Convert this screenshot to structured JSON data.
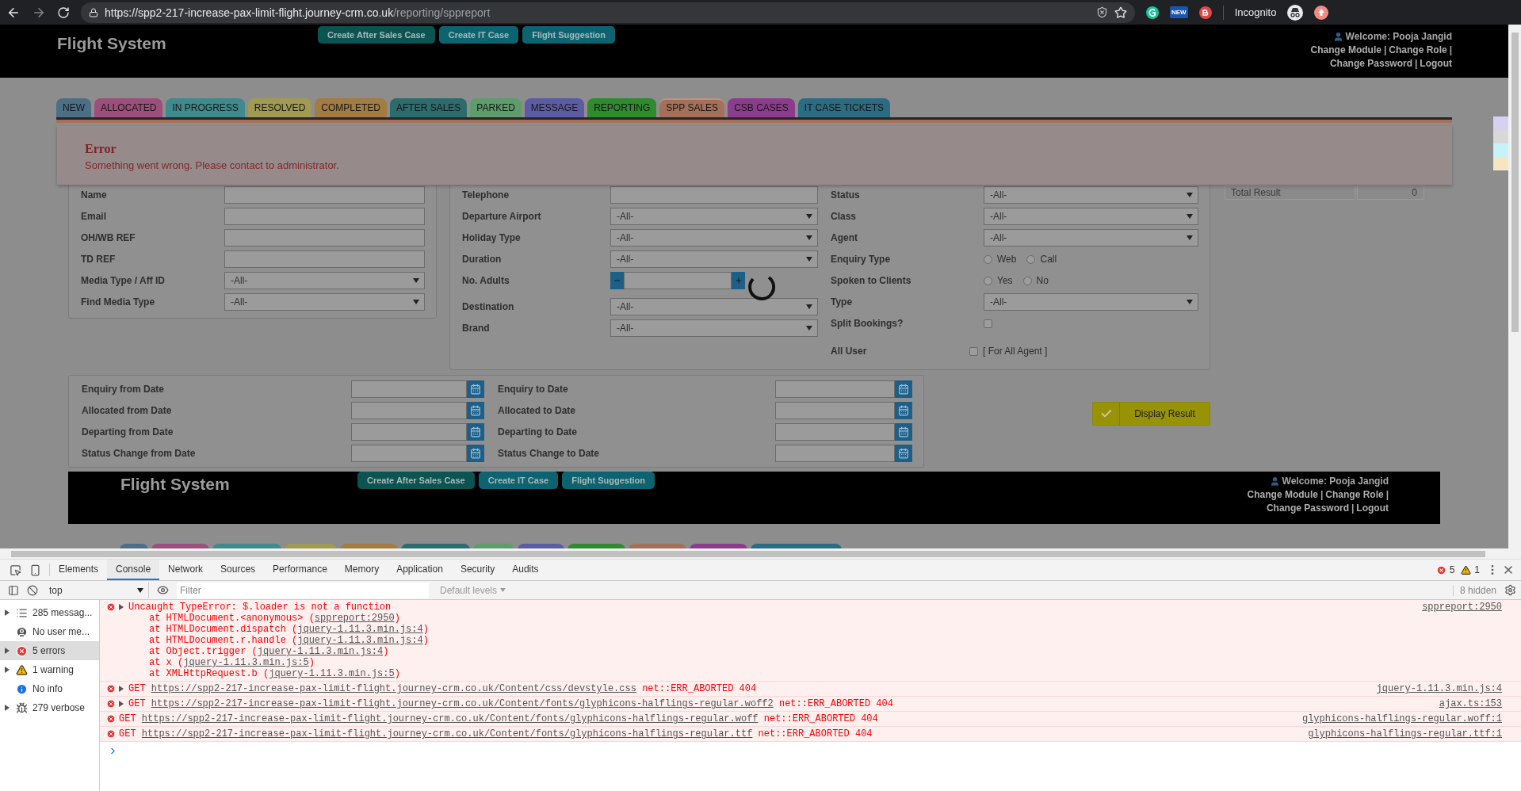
{
  "browser": {
    "url_host": "https://spp2-217-increase-pax-limit-flight.journey-crm.co.uk",
    "url_path": "/reporting/sppreport",
    "extension_badge": "NEW",
    "profile": "Incognito"
  },
  "header": {
    "title": "Flight System",
    "buttons": [
      "Create After Sales Case",
      "Create IT Case",
      "Flight Suggestion"
    ],
    "welcome": "Welcome: Pooja Jangid",
    "link_rows": [
      [
        {
          "kind": "link",
          "text": "Change Module"
        },
        {
          "kind": "separator",
          "text": "|"
        },
        {
          "kind": "link",
          "text": "Change Role"
        },
        {
          "kind": "separator",
          "text": "|"
        }
      ],
      [
        {
          "kind": "link",
          "text": "Change Password"
        },
        {
          "kind": "separator",
          "text": "|"
        },
        {
          "kind": "link",
          "text": "Logout"
        }
      ]
    ]
  },
  "tabs": [
    {
      "label": "NEW",
      "color": "#4d6f86",
      "selected": false
    },
    {
      "label": "ALLOCATED",
      "color": "#9c4f7c",
      "selected": false
    },
    {
      "label": "IN PROGRESS",
      "color": "#3f8a8c",
      "selected": false
    },
    {
      "label": "RESOLVED",
      "color": "#a09a52",
      "selected": false
    },
    {
      "label": "COMPLETED",
      "color": "#a37c42",
      "selected": false
    },
    {
      "label": "AFTER SALES",
      "color": "#2c6c6c",
      "selected": false
    },
    {
      "label": "PARKED",
      "color": "#5e9c6c",
      "selected": false
    },
    {
      "label": "MESSAGE",
      "color": "#5c5ca4",
      "selected": false
    },
    {
      "label": "REPORTING",
      "color": "#2e8c2e",
      "selected": false
    },
    {
      "label": "SPP SALES",
      "color": "#a5705a",
      "selected": true
    },
    {
      "label": "CSB CASES",
      "color": "#8c3c8c",
      "selected": false
    },
    {
      "label": "IT CASE TICKETS",
      "color": "#2c6c82",
      "selected": false
    }
  ],
  "error": {
    "title": "Error",
    "message": "Something went wrong. Please contact to administrator."
  },
  "filters": {
    "left": [
      {
        "kind": "text",
        "label": "Name"
      },
      {
        "kind": "text",
        "label": "Email"
      },
      {
        "kind": "text",
        "label": "OH/WB REF"
      },
      {
        "kind": "text",
        "label": "TD REF"
      },
      {
        "kind": "select",
        "label": "Media Type / Aff ID",
        "value": "-All-"
      },
      {
        "kind": "select",
        "label": "Find Media Type",
        "value": "-All-"
      }
    ],
    "middle": [
      {
        "kind": "text",
        "label": "Telephone"
      },
      {
        "kind": "select",
        "label": "Departure Airport",
        "value": "-All-"
      },
      {
        "kind": "select",
        "label": "Holiday Type",
        "value": "-All-"
      },
      {
        "kind": "select",
        "label": "Duration",
        "value": "-All-"
      },
      {
        "kind": "stepper",
        "label": "No. Adults"
      },
      {
        "kind": "select",
        "label": "Destination",
        "value": "-All-"
      },
      {
        "kind": "select",
        "label": "Brand",
        "value": "-All-"
      }
    ],
    "right": [
      {
        "kind": "select",
        "label": "Status",
        "value": "-All-"
      },
      {
        "kind": "select",
        "label": "Class",
        "value": "-All-"
      },
      {
        "kind": "select",
        "label": "Agent",
        "value": "-All-"
      },
      {
        "kind": "radio",
        "label": "Enquiry Type",
        "options": [
          {
            "label": "Web",
            "selected": false
          },
          {
            "label": "Call",
            "selected": false
          }
        ]
      },
      {
        "kind": "radio",
        "label": "Spoken to Clients",
        "options": [
          {
            "label": "Yes",
            "selected": false
          },
          {
            "label": "No",
            "selected": false
          }
        ]
      },
      {
        "kind": "select",
        "label": "Type",
        "value": "-All-"
      },
      {
        "kind": "checkbox",
        "label": "Split Bookings?",
        "checked": false
      },
      {
        "kind": "checkbox_label",
        "label": "All User",
        "option": "[ For All Agent ]",
        "checked": false
      }
    ]
  },
  "total_result": {
    "label": "Total Result",
    "value": "0"
  },
  "date_rows": [
    {
      "from": "Enquiry from Date",
      "to": "Enquiry to Date"
    },
    {
      "from": "Allocated from Date",
      "to": "Allocated to Date"
    },
    {
      "from": "Departing from Date",
      "to": "Departing to Date"
    },
    {
      "from": "Status Change from Date",
      "to": "Status Change to Date"
    }
  ],
  "display_button": "Display Result",
  "footer": {
    "title": "Flight System",
    "buttons": [
      "Create After Sales Case",
      "Create IT Case",
      "Flight Suggestion"
    ],
    "welcome": "Welcome: Pooja Jangid",
    "link_rows": [
      [
        {
          "kind": "link",
          "text": "Change Module"
        },
        {
          "kind": "separator",
          "text": "|"
        },
        {
          "kind": "link",
          "text": "Change Role"
        },
        {
          "kind": "separator",
          "text": "|"
        }
      ],
      [
        {
          "kind": "link",
          "text": "Change Password"
        },
        {
          "kind": "separator",
          "text": "|"
        },
        {
          "kind": "link",
          "text": "Logout"
        }
      ]
    ]
  },
  "devtools": {
    "tabs": [
      {
        "label": "Elements",
        "selected": false
      },
      {
        "label": "Console",
        "selected": true
      },
      {
        "label": "Network",
        "selected": false
      },
      {
        "label": "Sources",
        "selected": false
      },
      {
        "label": "Performance",
        "selected": false
      },
      {
        "label": "Memory",
        "selected": false
      },
      {
        "label": "Application",
        "selected": false
      },
      {
        "label": "Security",
        "selected": false
      },
      {
        "label": "Audits",
        "selected": false
      }
    ],
    "error_count": "5",
    "warning_count": "1",
    "context": "top",
    "filter_placeholder": "Filter",
    "levels": "Default levels",
    "hidden": "8 hidden",
    "sidebar": [
      {
        "kind": "messages",
        "label": "285 messag...",
        "expandable": true,
        "selected": false
      },
      {
        "kind": "user",
        "label": "No user me...",
        "expandable": false,
        "selected": false
      },
      {
        "kind": "errors",
        "label": "5 errors",
        "expandable": true,
        "selected": true
      },
      {
        "kind": "warnings",
        "label": "1 warning",
        "expandable": true,
        "selected": false
      },
      {
        "kind": "info",
        "label": "No info",
        "expandable": false,
        "selected": false
      },
      {
        "kind": "verbose",
        "label": "279 verbose",
        "expandable": true,
        "selected": false
      }
    ],
    "messages": [
      {
        "kind": "exception",
        "expandable": true,
        "text": "Uncaught TypeError: $.loader is not a function",
        "source": "sppreport:2950",
        "stack": [
          {
            "text": "at HTMLDocument.<anonymous> (",
            "link": "sppreport:2950",
            "suffix": ")"
          },
          {
            "text": "at HTMLDocument.dispatch (",
            "link": "jquery-1.11.3.min.js:4",
            "suffix": ")"
          },
          {
            "text": "at HTMLDocument.r.handle (",
            "link": "jquery-1.11.3.min.js:4",
            "suffix": ")"
          },
          {
            "text": "at Object.trigger (",
            "link": "jquery-1.11.3.min.js:4",
            "suffix": ")"
          },
          {
            "text": "at x (",
            "link": "jquery-1.11.3.min.js:5",
            "suffix": ")"
          },
          {
            "text": "at XMLHttpRequest.b (",
            "link": "jquery-1.11.3.min.js:5",
            "suffix": ")"
          }
        ]
      },
      {
        "kind": "request",
        "expandable": true,
        "method": "GET",
        "url": "https://spp2-217-increase-pax-limit-flight.journey-crm.co.uk/Content/css/devstyle.css",
        "status": "net::ERR_ABORTED 404",
        "source": "jquery-1.11.3.min.js:4"
      },
      {
        "kind": "request",
        "expandable": true,
        "method": "GET",
        "url": "https://spp2-217-increase-pax-limit-flight.journey-crm.co.uk/Content/fonts/glyphicons-halflings-regular.woff2",
        "status": "net::ERR_ABORTED 404",
        "source": "ajax.ts:153"
      },
      {
        "kind": "request",
        "expandable": false,
        "method": "GET",
        "url": "https://spp2-217-increase-pax-limit-flight.journey-crm.co.uk/Content/fonts/glyphicons-halflings-regular.woff",
        "status": "net::ERR_ABORTED 404",
        "source": "glyphicons-halflings-regular.woff:1"
      },
      {
        "kind": "request",
        "expandable": false,
        "method": "GET",
        "url": "https://spp2-217-increase-pax-limit-flight.journey-crm.co.uk/Content/fonts/glyphicons-halflings-regular.ttf",
        "status": "net::ERR_ABORTED 404",
        "source": "glyphicons-halflings-regular.ttf:1"
      }
    ]
  }
}
